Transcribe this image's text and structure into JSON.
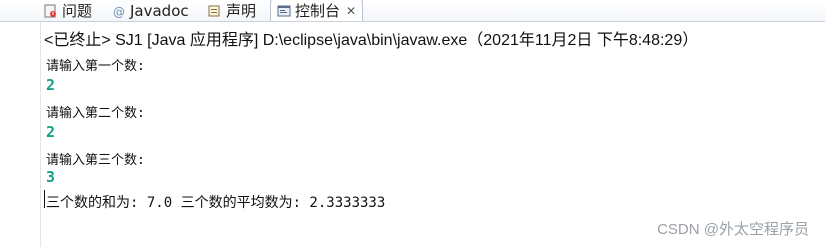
{
  "tabs": [
    {
      "id": "problems",
      "label": "问题",
      "icon": "problems-icon"
    },
    {
      "id": "javadoc",
      "label": "Javadoc",
      "icon": "at-icon"
    },
    {
      "id": "declaration",
      "label": "声明",
      "icon": "declaration-icon"
    },
    {
      "id": "console",
      "label": "控制台",
      "icon": "console-icon",
      "active": true,
      "close": "✕"
    }
  ],
  "console": {
    "status": "<已终止> SJ1 [Java 应用程序] D:\\eclipse\\java\\bin\\javaw.exe（2021年11月2日 下午8:48:29）",
    "lines": [
      {
        "type": "prompt",
        "text": "请输入第一个数:"
      },
      {
        "type": "input",
        "text": "2"
      },
      {
        "type": "prompt",
        "text": "请输入第二个数:"
      },
      {
        "type": "input",
        "text": "2"
      },
      {
        "type": "prompt",
        "text": "请输入第三个数:"
      },
      {
        "type": "input",
        "text": "3"
      },
      {
        "type": "result",
        "text": "三个数的和为: 7.0  三个数的平均数为: 2.3333333"
      }
    ]
  },
  "watermark": "CSDN @外太空程序员",
  "colors": {
    "input": "#16a085",
    "tab_border": "#b9c3d0"
  }
}
